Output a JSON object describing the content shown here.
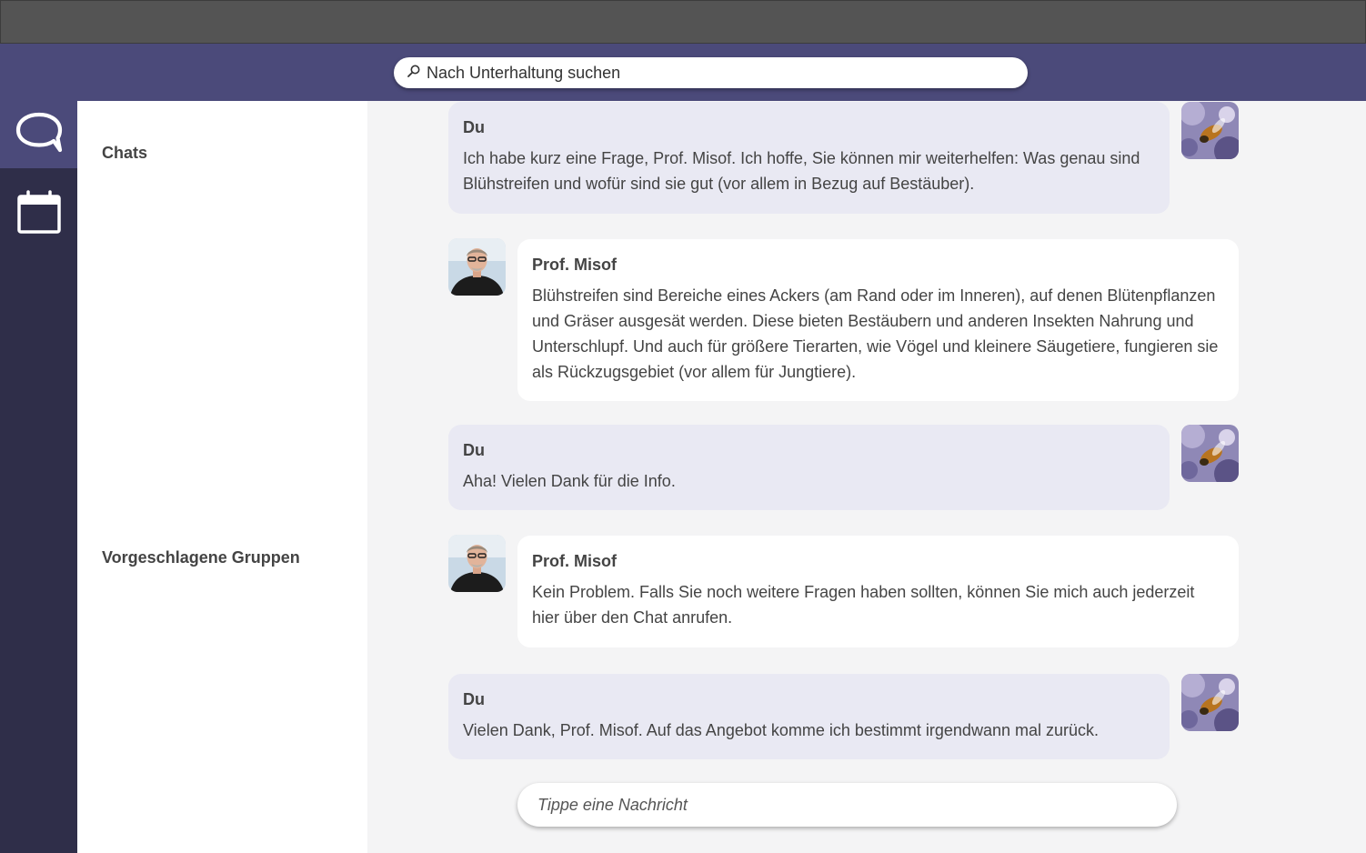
{
  "search": {
    "icon": "search-icon",
    "placeholder": "Nach Unterhaltung suchen"
  },
  "rail": {
    "items": [
      {
        "name": "chats",
        "icon": "chat-bubble-icon",
        "active": true
      },
      {
        "name": "calendar",
        "icon": "calendar-icon",
        "active": false
      }
    ]
  },
  "sidebar": {
    "chats_title": "Chats",
    "groups_title": "Vorgeschlagene Gruppen"
  },
  "messages": [
    {
      "from": "me",
      "sender": "Du",
      "text": "Ich habe kurz eine Frage, Prof. Misof. Ich hoffe, Sie können mir weiterhelfen: Was genau sind Blühstreifen und wofür sind sie gut (vor allem in Bezug auf Bestäuber)."
    },
    {
      "from": "them",
      "sender": "Prof. Misof",
      "text": "Blühstreifen sind Bereiche eines Ackers (am Rand oder im Inneren), auf denen Blütenpflanzen und Gräser ausgesät werden. Diese bieten Bestäubern und anderen Insekten Nahrung und Unterschlupf. Und auch für größere Tierarten, wie Vögel und kleinere Säugetiere, fungieren sie als Rückzugsgebiet (vor allem für Jungtiere)."
    },
    {
      "from": "me",
      "sender": "Du",
      "text": "Aha! Vielen Dank für die Info."
    },
    {
      "from": "them",
      "sender": "Prof. Misof",
      "text": "Kein Problem. Falls Sie noch weitere Fragen haben sollten, können Sie mich auch jederzeit hier über den Chat anrufen."
    },
    {
      "from": "me",
      "sender": "Du",
      "text": "Vielen Dank, Prof. Misof. Auf das Angebot komme ich bestimmt irgendwann mal zurück."
    }
  ],
  "composer": {
    "placeholder": "Tippe eine Nachricht"
  },
  "colors": {
    "header": "#4b4a7a",
    "rail": "#2f2e49",
    "my_bubble": "#e9e9f3",
    "their_bubble": "#ffffff"
  }
}
